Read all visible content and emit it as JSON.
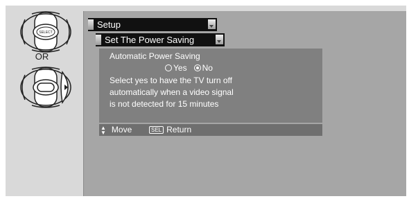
{
  "remote": {
    "select_key_label": "SELECT",
    "or_label": "OR",
    "top_icon": "dpad-select-button-icon",
    "bottom_icon": "dpad-right-button-icon"
  },
  "menu": {
    "setup_label": "Setup",
    "power_saving_label": "Set The Power Saving"
  },
  "panel": {
    "heading": "Automatic Power Saving",
    "option_yes": "Yes",
    "option_no": "No",
    "selected_option": "No",
    "description_line1": "Select yes to have the TV turn off",
    "description_line2": "automatically when a video signal",
    "description_line3": "is not detected for 15 minutes"
  },
  "footer": {
    "move_label": "Move",
    "sel_key": "SEL",
    "return_label": "Return"
  }
}
